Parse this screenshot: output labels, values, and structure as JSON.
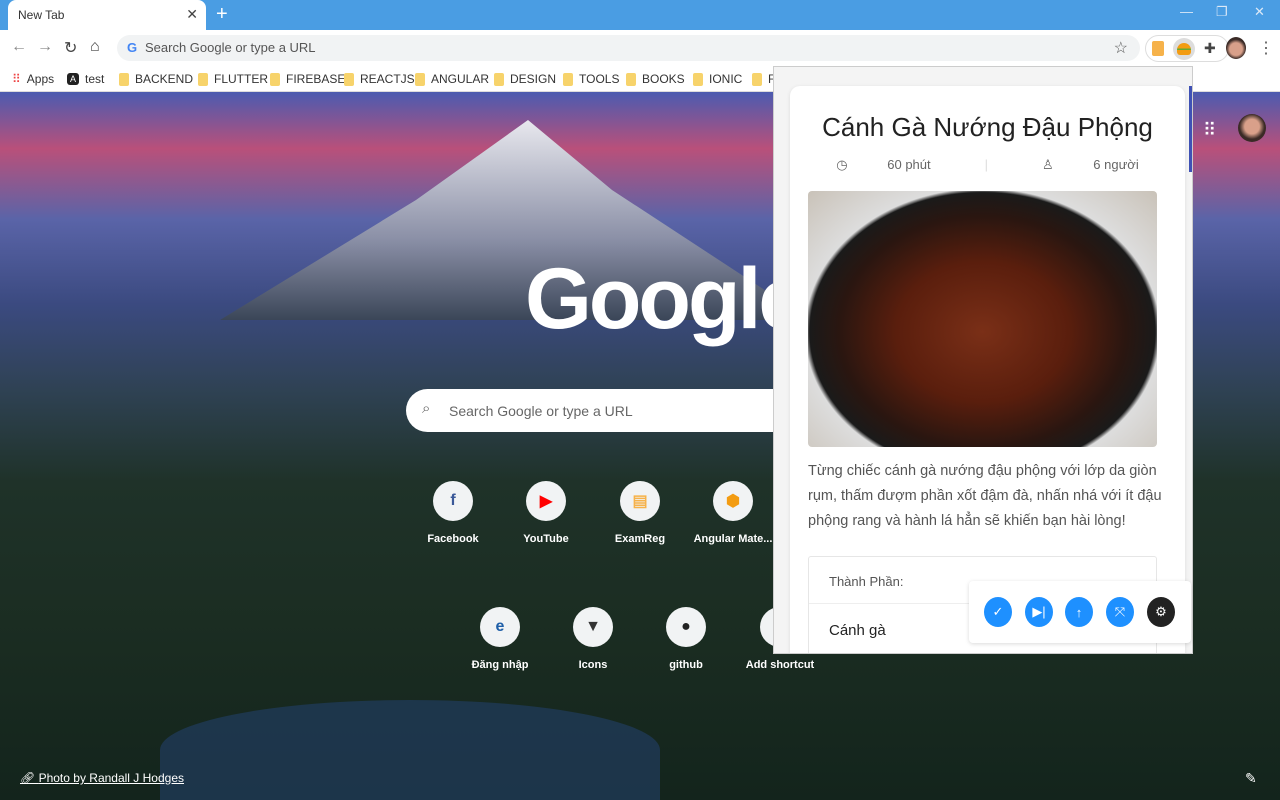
{
  "browser": {
    "tab_title": "New Tab",
    "omnibox_placeholder": "Search Google or type a URL",
    "bookmarks": [
      "Apps",
      "test",
      "BACKEND",
      "FLUTTER",
      "FIREBASE",
      "REACTJS",
      "ANGULAR",
      "DESIGN",
      "TOOLS",
      "BOOKS",
      "IONIC",
      "F"
    ]
  },
  "ntp": {
    "logo": "Google",
    "search_placeholder": "Search Google or type a URL",
    "shortcuts": [
      {
        "label": "Facebook",
        "icon": "f",
        "color": "#3b5998"
      },
      {
        "label": "YouTube",
        "icon": "▶",
        "color": "#ff0000"
      },
      {
        "label": "ExamReg",
        "icon": "▤",
        "color": "#f6b24a"
      },
      {
        "label": "Angular Mate...",
        "icon": "⬢",
        "color": "#f39c12"
      },
      {
        "label": "Đăng nhập",
        "icon": "e",
        "color": "#1f5fa8"
      },
      {
        "label": "Icons",
        "icon": "▼",
        "color": "#333"
      },
      {
        "label": "github",
        "icon": "●",
        "color": "#222"
      },
      {
        "label": "Add shortcut",
        "icon": "+",
        "color": "#333"
      }
    ],
    "photo_credit": "Photo by Randall J Hodges"
  },
  "recipe": {
    "title": "Cánh Gà Nướng Đậu Phộng",
    "time": "60 phút",
    "servings": "6 người",
    "description": "Từng chiếc cánh gà nướng đậu phộng với lớp da giòn rụm, thấm đượm phần xốt đậm đà, nhấn nhá với ít đậu phộng rang và hành lá hẳn sẽ khiến bạn hài lòng!",
    "ingredients_header": "Thành Phần:",
    "ingredients": [
      "Cánh gà"
    ]
  },
  "colors": {
    "accent": "#1e90ff",
    "titlebar": "#4a9de3"
  }
}
